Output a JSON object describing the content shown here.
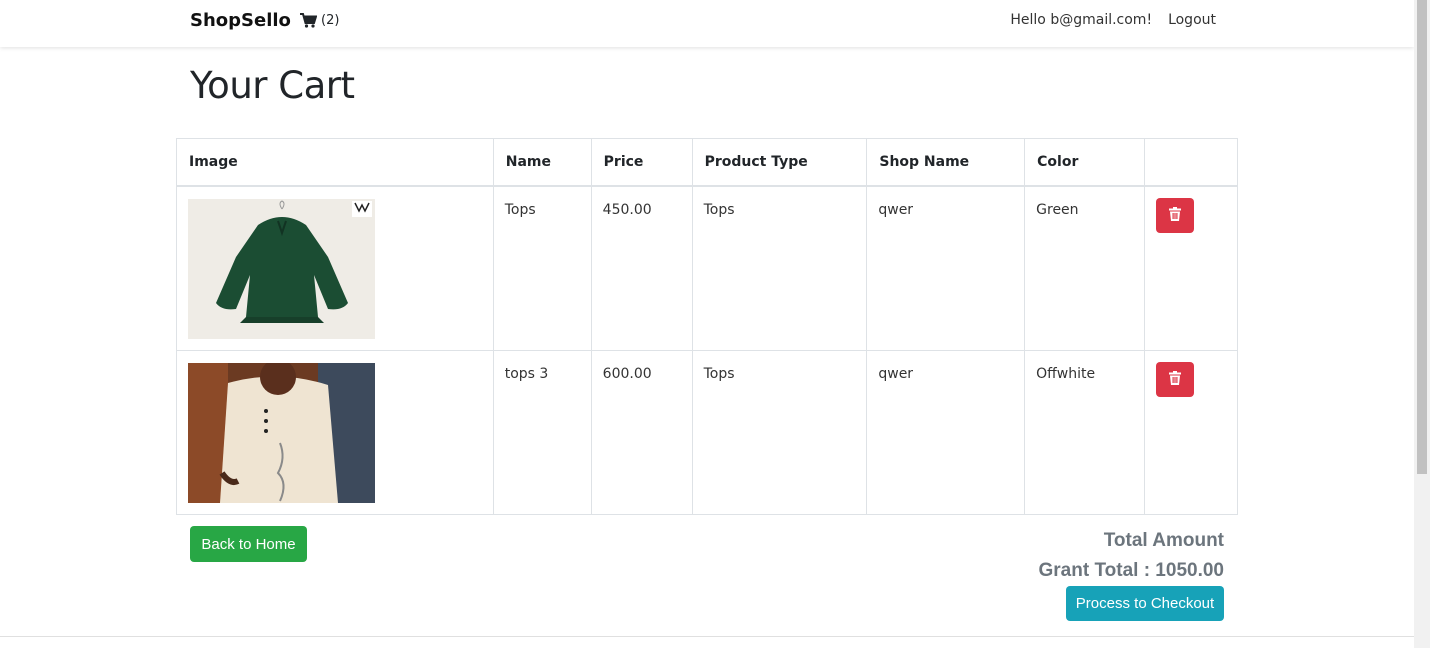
{
  "navbar": {
    "brand": "ShopSello",
    "cart_count": "(2)",
    "greeting": "Hello b@gmail.com!",
    "logout": "Logout"
  },
  "page": {
    "title": "Your Cart"
  },
  "table": {
    "headers": [
      "Image",
      "Name",
      "Price",
      "Product Type",
      "Shop Name",
      "Color",
      ""
    ],
    "rows": [
      {
        "name": "Tops",
        "price": "450.00",
        "type": "Tops",
        "shop": "qwer",
        "color": "Green",
        "image_icon": "green-top-image"
      },
      {
        "name": "tops 3",
        "price": "600.00",
        "type": "Tops",
        "shop": "qwer",
        "color": "Offwhite",
        "image_icon": "offwhite-top-image"
      }
    ]
  },
  "actions": {
    "back": "Back to Home",
    "checkout": "Process to Checkout"
  },
  "totals": {
    "label": "Total Amount",
    "grand": "Grant Total : 1050.00"
  },
  "colors": {
    "danger": "#dc3545",
    "success": "#28a745",
    "info": "#17a2b8",
    "muted": "#6c757d"
  }
}
